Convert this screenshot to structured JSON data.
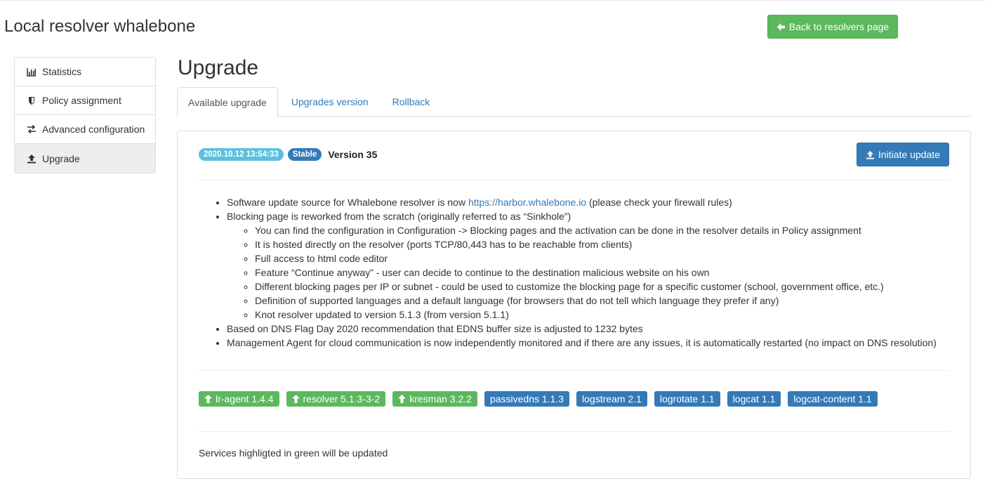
{
  "header": {
    "title": "Local resolver whalebone",
    "back_button": "Back to resolvers page"
  },
  "sidebar": {
    "items": [
      {
        "label": "Statistics",
        "icon": "bar-chart-icon"
      },
      {
        "label": "Policy assignment",
        "icon": "shield-icon"
      },
      {
        "label": "Advanced configuration",
        "icon": "transfer-icon"
      },
      {
        "label": "Upgrade",
        "icon": "upload-icon",
        "active": true
      }
    ]
  },
  "main": {
    "title": "Upgrade",
    "tabs": [
      {
        "label": "Available upgrade",
        "active": true
      },
      {
        "label": "Upgrades version"
      },
      {
        "label": "Rollback"
      }
    ]
  },
  "release": {
    "date": "2020.10.12 13:54:33",
    "channel": "Stable",
    "version": "Version 35",
    "initiate_button": "Initiate update",
    "notes": {
      "item1_prefix": "Software update source for Whalebone resolver is now ",
      "item1_link": "https://harbor.whalebone.io",
      "item1_suffix": " (please check your firewall rules)",
      "item2": "Blocking page is reworked from the scratch (originally referred to as “Sinkhole”)",
      "sub": [
        "You can find the configuration in Configuration -> Blocking pages and the activation can be done in the resolver details in Policy assignment",
        "It is hosted directly on the resolver (ports TCP/80,443 has to be reachable from clients)",
        "Full access to html code editor",
        "Feature “Continue anyway” - user can decide to continue to the destination malicious website on his own",
        "Different blocking pages per IP or subnet - could be used to customize the blocking page for a specific customer (school, government office, etc.)",
        "Definition of supported languages and a default language (for browsers that do not tell which language they prefer if any)",
        "Knot resolver updated to version 5.1.3 (from version 5.1.1)"
      ],
      "item3": "Based on DNS Flag Day 2020 recommendation that EDNS buffer size is adjusted to 1232 bytes",
      "item4": "Management Agent for cloud communication is now independently monitored and if there are any issues, it is automatically restarted (no impact on DNS resolution)"
    },
    "packages": [
      {
        "label": "lr-agent 1.4.4",
        "updated": true
      },
      {
        "label": "resolver 5.1.3-3-2",
        "updated": true
      },
      {
        "label": "kresman 3.2.2",
        "updated": true
      },
      {
        "label": "passivedns 1.1.3",
        "updated": false
      },
      {
        "label": "logstream 2.1",
        "updated": false
      },
      {
        "label": "logrotate 1.1",
        "updated": false
      },
      {
        "label": "logcat 1.1",
        "updated": false
      },
      {
        "label": "logcat-content 1.1",
        "updated": false
      }
    ],
    "footnote": "Services highligted in green will be updated"
  },
  "colors": {
    "success": "#5cb85c",
    "primary": "#337ab7",
    "info": "#5bc0de"
  }
}
